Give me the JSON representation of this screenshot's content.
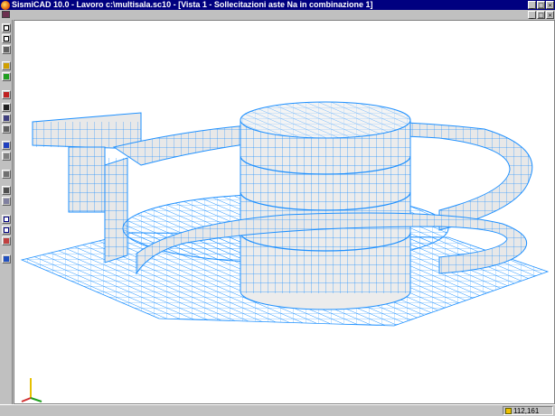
{
  "window": {
    "title": "SismiCAD 10.0 - Lavoro c:\\multisala.sc10 - [Vista 1 - Sollecitazioni aste Na in combinazione 1]",
    "controls": [
      "_",
      "□",
      "×"
    ]
  },
  "mdi": {
    "controls": [
      "_",
      "□",
      "×"
    ]
  },
  "toolbar": {
    "buttons": [
      "new-file-icon",
      "copy-icon",
      "nodes-icon",
      "pen-icon",
      "layer-icon",
      "cross-icon",
      "binoculars-icon",
      "zoom-icon",
      "rotate-icon",
      "query-icon",
      "section-icon",
      "stack-icon",
      "frame-icon",
      "wire-icon",
      "window-icon",
      "window-split-icon",
      "view-icon",
      "exit-icon"
    ]
  },
  "status": {
    "coordinates": "112,161"
  },
  "colors": {
    "mesh": "#1e90ff",
    "fill": "#e8e8e8",
    "title": "#000080"
  }
}
